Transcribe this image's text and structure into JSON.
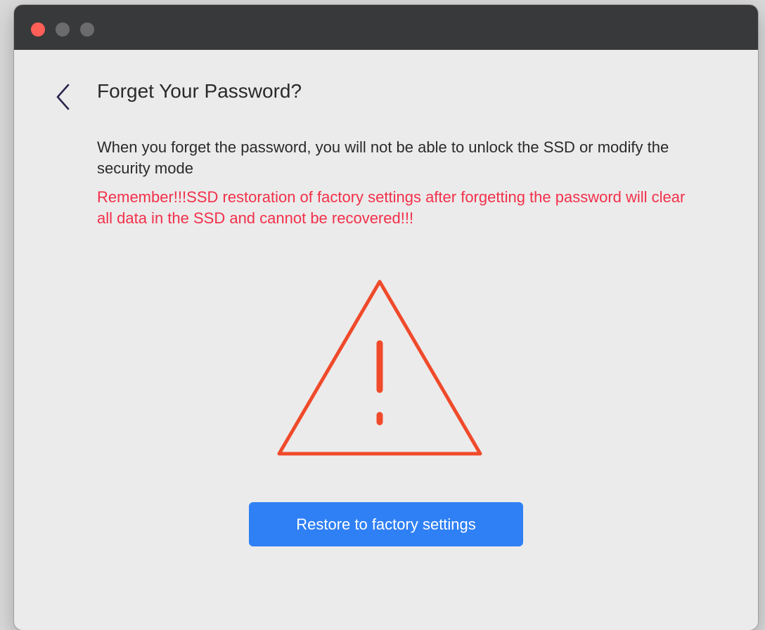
{
  "window": {
    "controls": [
      "close",
      "minimize",
      "maximize"
    ]
  },
  "header": {
    "back_icon": "chevron-left-icon",
    "title": "Forget Your Password?"
  },
  "content": {
    "description": "When you forget the password, you will not be able to unlock the SSD or modify the security mode",
    "warning": "Remember!!!SSD restoration of factory settings after forgetting the password will clear all data in the SSD and cannot be recovered!!!",
    "warning_icon": "warning-triangle-icon"
  },
  "actions": {
    "restore_label": "Restore to factory settings"
  },
  "colors": {
    "titlebar": "#38393b",
    "background": "#ebebeb",
    "warning_text": "#f2304a",
    "warning_icon": "#f04a2b",
    "primary_button": "#2f80f5",
    "traffic_close": "#ff5f57"
  }
}
